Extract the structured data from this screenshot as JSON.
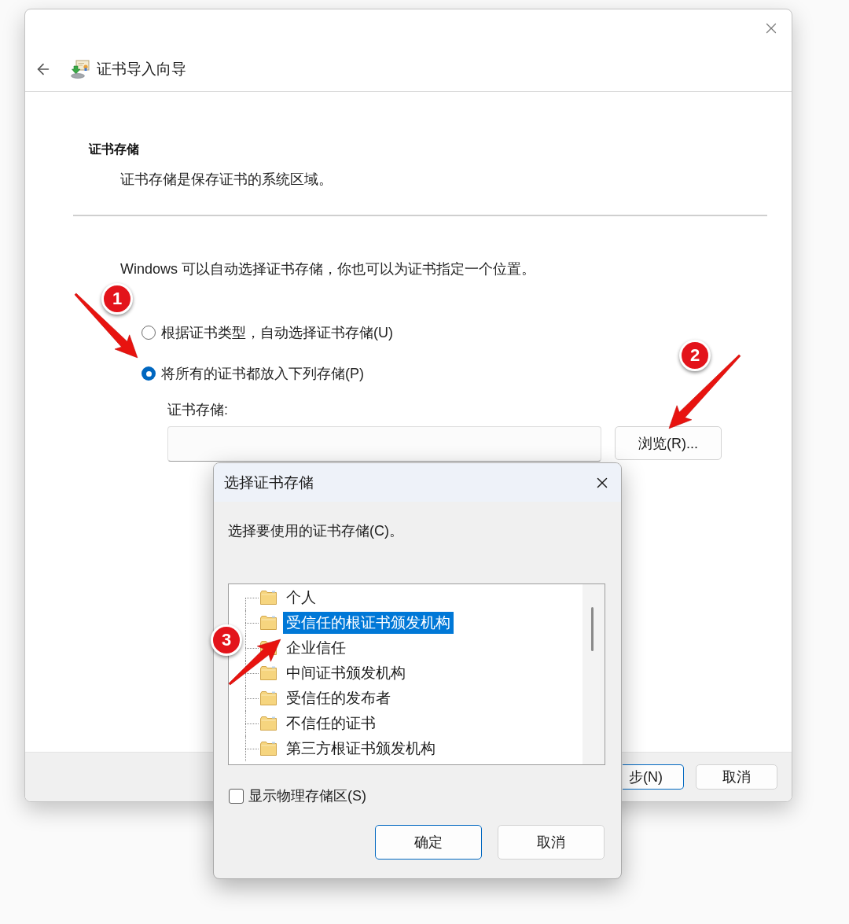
{
  "wizard": {
    "title": "证书导入向导",
    "section": {
      "heading": "证书存储",
      "description": "证书存储是保存证书的系统区域。"
    },
    "intro": "Windows 可以自动选择证书存储，你也可以为证书指定一个位置。",
    "options": [
      {
        "label": "根据证书类型，自动选择证书存储(U)",
        "selected": false
      },
      {
        "label": "将所有的证书都放入下列存储(P)",
        "selected": true
      }
    ],
    "store_label": "证书存储:",
    "browse_button": "浏览(R)...",
    "footer_buttons": [
      {
        "label": "步(N)",
        "default": true
      },
      {
        "label": "取消",
        "default": false
      }
    ]
  },
  "dialog": {
    "title": "选择证书存储",
    "prompt": "选择要使用的证书存储(C)。",
    "stores": [
      {
        "label": "个人",
        "selected": false
      },
      {
        "label": "受信任的根证书颁发机构",
        "selected": true
      },
      {
        "label": "企业信任",
        "selected": false
      },
      {
        "label": "中间证书颁发机构",
        "selected": false
      },
      {
        "label": "受信任的发布者",
        "selected": false
      },
      {
        "label": "不信任的证书",
        "selected": false
      },
      {
        "label": "第三方根证书颁发机构",
        "selected": false
      }
    ],
    "show_physical": {
      "label": "显示物理存储区(S)",
      "checked": false
    },
    "buttons": [
      {
        "label": "确定",
        "default": true
      },
      {
        "label": "取消",
        "default": false
      }
    ]
  },
  "annotations": [
    {
      "number": "1"
    },
    {
      "number": "2"
    },
    {
      "number": "3"
    }
  ]
}
